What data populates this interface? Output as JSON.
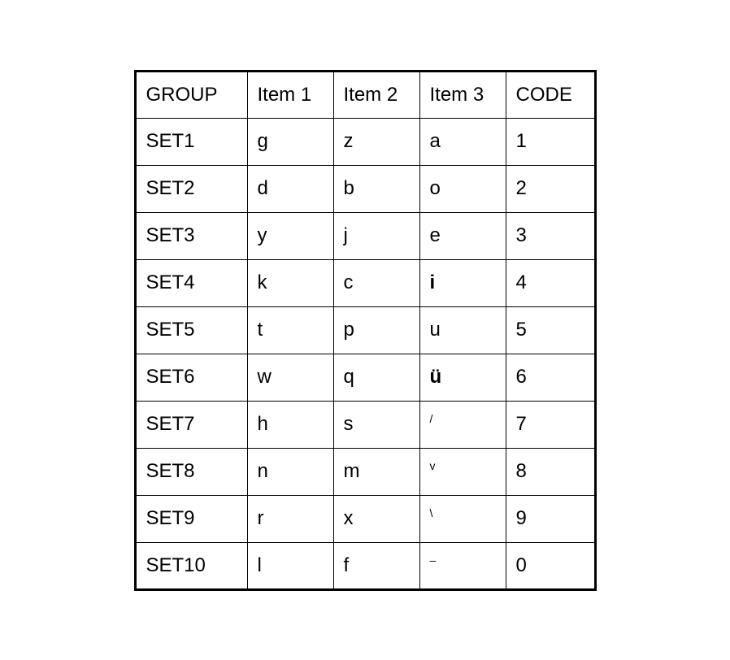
{
  "table": {
    "headers": {
      "col1": "GROUP",
      "col2": "Item 1",
      "col3": "Item 2",
      "col4": "Item 3",
      "col5": "CODE"
    },
    "rows": [
      {
        "group": "SET1",
        "item1": "g",
        "item2": "z",
        "item3": "a",
        "code": "1",
        "item3_bold": false,
        "item3_sup": false
      },
      {
        "group": "SET2",
        "item1": "d",
        "item2": "b",
        "item3": "o",
        "code": "2",
        "item3_bold": false,
        "item3_sup": false
      },
      {
        "group": "SET3",
        "item1": "y",
        "item2": "j",
        "item3": "e",
        "code": "3",
        "item3_bold": false,
        "item3_sup": false
      },
      {
        "group": "SET4",
        "item1": "k",
        "item2": "c",
        "item3": "i",
        "code": "4",
        "item3_bold": true,
        "item3_sup": false
      },
      {
        "group": "SET5",
        "item1": "t",
        "item2": "p",
        "item3": "u",
        "code": "5",
        "item3_bold": false,
        "item3_sup": false
      },
      {
        "group": "SET6",
        "item1": "w",
        "item2": "q",
        "item3": "ü",
        "code": "6",
        "item3_bold": true,
        "item3_sup": false
      },
      {
        "group": "SET7",
        "item1": "h",
        "item2": "s",
        "item3": "/",
        "code": "7",
        "item3_bold": false,
        "item3_sup": true
      },
      {
        "group": "SET8",
        "item1": "n",
        "item2": "m",
        "item3": "v",
        "code": "8",
        "item3_bold": false,
        "item3_sup": true
      },
      {
        "group": "SET9",
        "item1": "r",
        "item2": "x",
        "item3": "\\",
        "code": "9",
        "item3_bold": false,
        "item3_sup": true
      },
      {
        "group": "SET10",
        "item1": "l",
        "item2": "f",
        "item3": "–",
        "code": "0",
        "item3_bold": false,
        "item3_sup": true
      }
    ]
  }
}
